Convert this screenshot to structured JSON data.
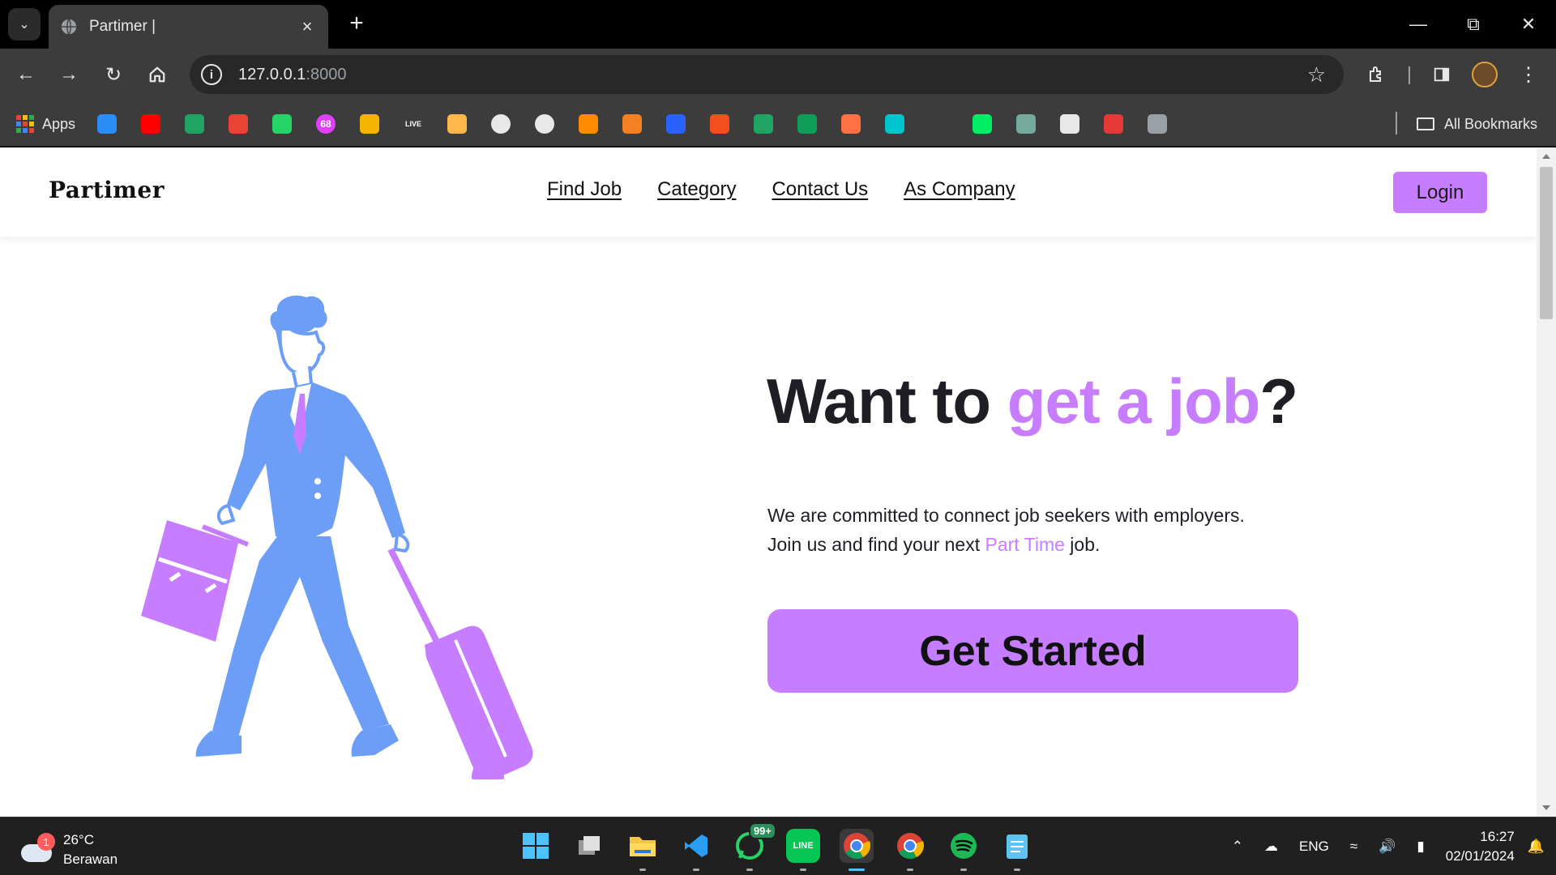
{
  "browser": {
    "tab_title": "Partimer |",
    "url_host": "127.0.0.1",
    "url_port": ":8000",
    "bookmarks_apps_label": "Apps",
    "all_bookmarks_label": "All Bookmarks",
    "bookmark_icons": [
      "onedrive-icon",
      "youtube-icon",
      "google-drive-icon",
      "gmail-icon",
      "whatsapp-icon",
      "badge-68-icon",
      "classroom-icon",
      "live-icon",
      "crown-icon",
      "globe-icon",
      "github-icon",
      "coursera-icon",
      "stackoverflow-icon",
      "bar-icon",
      "figma-icon",
      "drive-icon",
      "sheets-icon",
      "diagram-icon",
      "canva-icon",
      "zero-icon",
      "mongodb-icon",
      "chatgpt-icon",
      "capcut-icon",
      "trello-icon",
      "dots-icon"
    ],
    "live_text": "LIVE",
    "badge_text": "68"
  },
  "site": {
    "brand": "Partimer",
    "nav": [
      "Find Job",
      "Category",
      "Contact Us",
      "As Company"
    ],
    "login_label": "Login",
    "hero": {
      "title_part1": "Want to ",
      "title_accent": "get a job",
      "title_part2": "?",
      "desc_line1": "We are committed to connect job seekers with employers.",
      "desc_line2_pre": "Join us and find your next ",
      "desc_line2_accent": "Part Time",
      "desc_line2_post": " job.",
      "cta_label": "Get Started"
    },
    "colors": {
      "accent": "#c77dff",
      "figure": "#6c9ef8",
      "text": "#1e1e24"
    }
  },
  "taskbar": {
    "weather_temp": "26°C",
    "weather_desc": "Berawan",
    "weather_badge": "1",
    "whatsapp_count": "99+",
    "line_label": "LINE",
    "language": "ENG",
    "time": "16:27",
    "date": "02/01/2024"
  }
}
